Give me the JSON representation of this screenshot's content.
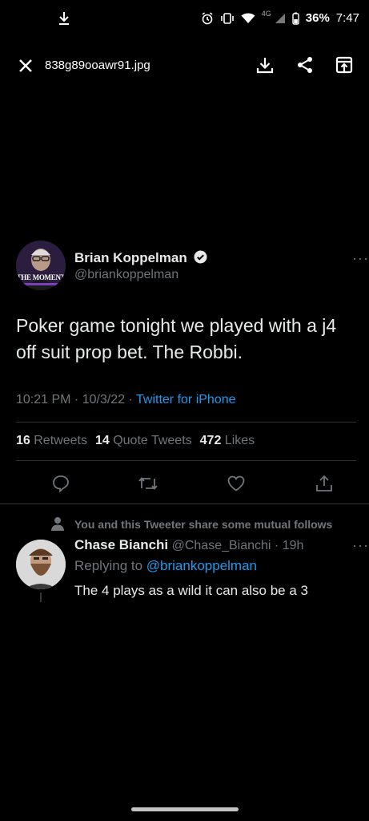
{
  "status_bar": {
    "battery": "36%",
    "time": "7:47",
    "network": "4G"
  },
  "viewer": {
    "filename": "838g89ooawr91.jpg",
    "icons": {
      "close": "close-icon",
      "download": "download-icon",
      "share": "share-icon",
      "open": "open-external-icon"
    }
  },
  "tweet": {
    "author_name": "Brian Koppelman",
    "author_handle": "@briankoppelman",
    "avatar_caption": "THE MOMENT",
    "text": "Poker game tonight we played with a j4 off suit prop bet. The Robbi.",
    "time": "10:21 PM · 10/3/22 · ",
    "source": "Twitter for iPhone",
    "stats": {
      "retweets_count": "16",
      "retweets_label": "Retweets",
      "quotes_count": "14",
      "quotes_label": "Quote Tweets",
      "likes_count": "472",
      "likes_label": "Likes"
    },
    "more": "···"
  },
  "reply": {
    "context": "You and this Tweeter share some mutual follows",
    "author_name": "Chase Bianchi",
    "author_handle": "@Chase_Bianchi",
    "time": " · 19h",
    "replying_prefix": "Replying to ",
    "replying_to": "@briankoppelman",
    "text": "The 4 plays as a wild it can also be a 3",
    "more": "···"
  },
  "colors": {
    "accent": "#1d9bf0",
    "muted": "#71767b",
    "background": "#000000",
    "text": "#e7e9ea"
  }
}
